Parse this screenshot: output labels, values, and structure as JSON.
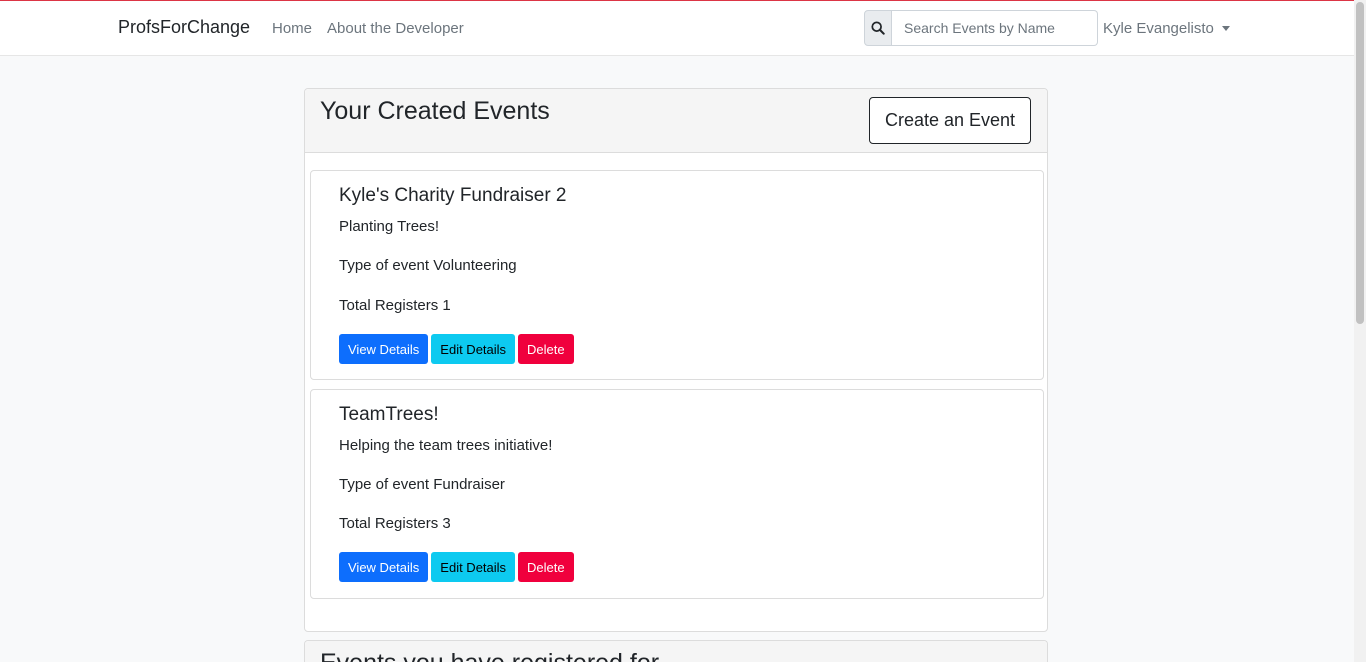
{
  "navbar": {
    "brand": "ProfsForChange",
    "links": [
      "Home",
      "About the Developer"
    ],
    "search_placeholder": "Search Events by Name",
    "user_name": "Kyle Evangelisto"
  },
  "created_events": {
    "title": "Your Created Events",
    "create_button": "Create an Event",
    "events": [
      {
        "name": "Kyle's Charity Fundraiser 2",
        "description": "Planting Trees!",
        "type_line": "Type of event Volunteering",
        "registers_line": "Total Registers 1",
        "buttons": {
          "view": "View Details",
          "edit": "Edit Details",
          "delete": "Delete"
        }
      },
      {
        "name": "TeamTrees!",
        "description": "Helping the team trees initiative!",
        "type_line": "Type of event Fundraiser",
        "registers_line": "Total Registers 3",
        "buttons": {
          "view": "View Details",
          "edit": "Edit Details",
          "delete": "Delete"
        }
      }
    ]
  },
  "registered_events": {
    "title": "Events you have registered for"
  },
  "colors": {
    "primary": "#0d6efd",
    "info": "#0dcaf0",
    "danger": "#f0003d",
    "accent_top": "#dc3545"
  }
}
